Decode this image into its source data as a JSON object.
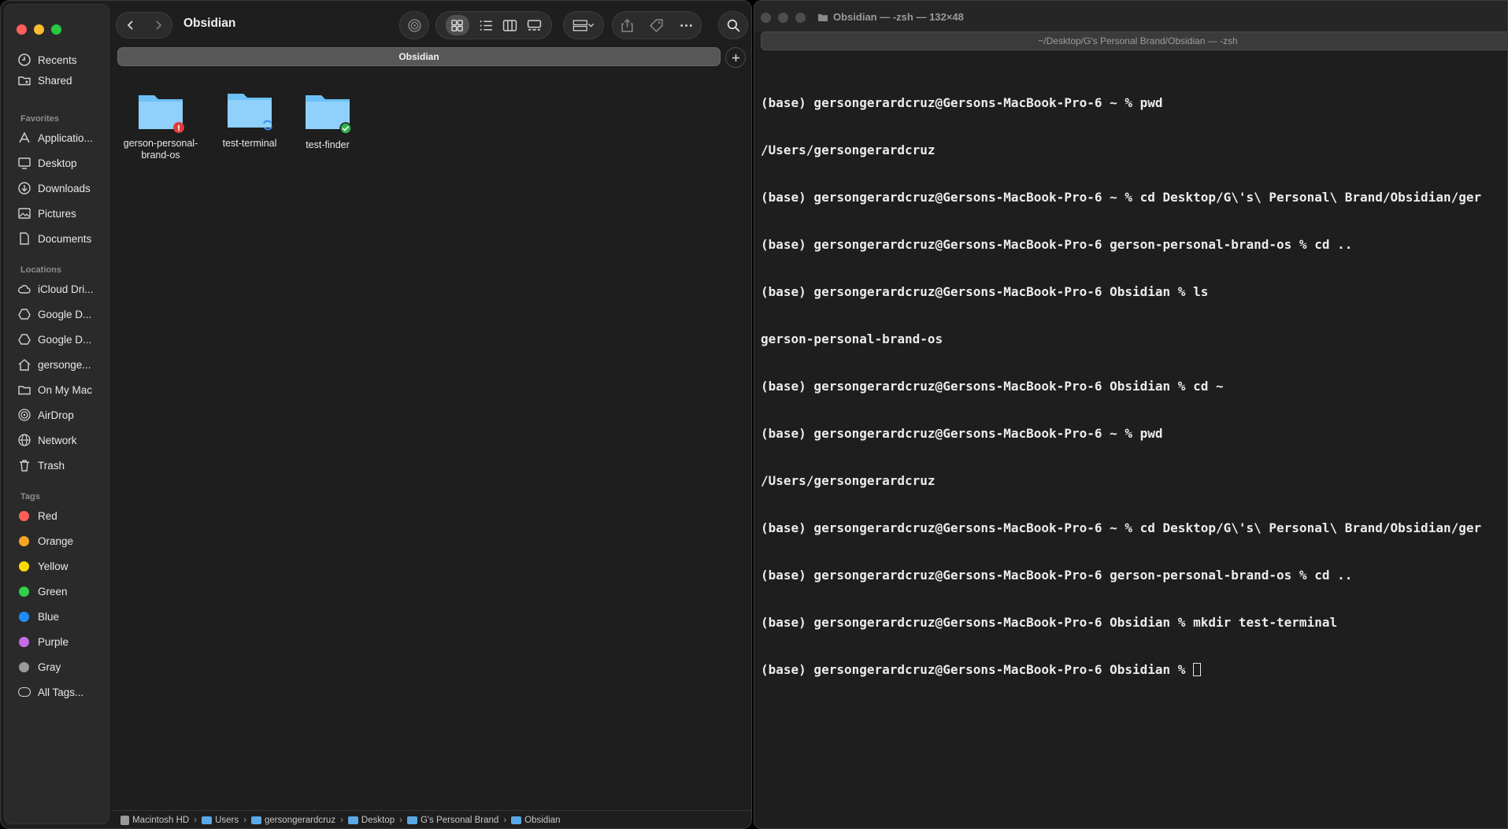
{
  "finder": {
    "title": "Obsidian",
    "path_tab": "Obsidian",
    "sidebar": {
      "top_items": [
        {
          "label": "Recents",
          "icon": "clock-icon"
        },
        {
          "label": "Shared",
          "icon": "shared-folder-icon"
        }
      ],
      "favorites_heading": "Favorites",
      "favorites": [
        {
          "label": "Applicatio...",
          "icon": "applications-icon"
        },
        {
          "label": "Desktop",
          "icon": "desktop-icon"
        },
        {
          "label": "Downloads",
          "icon": "download-icon"
        },
        {
          "label": "Pictures",
          "icon": "pictures-icon"
        },
        {
          "label": "Documents",
          "icon": "document-icon"
        }
      ],
      "locations_heading": "Locations",
      "locations": [
        {
          "label": "iCloud Dri...",
          "icon": "cloud-icon"
        },
        {
          "label": "Google D...",
          "icon": "google-drive-icon"
        },
        {
          "label": "Google D...",
          "icon": "google-drive-icon"
        },
        {
          "label": "gersonge...",
          "icon": "home-icon"
        },
        {
          "label": "On My Mac",
          "icon": "folder-icon"
        },
        {
          "label": "AirDrop",
          "icon": "airdrop-icon"
        },
        {
          "label": "Network",
          "icon": "globe-icon"
        },
        {
          "label": "Trash",
          "icon": "trash-icon"
        }
      ],
      "tags_heading": "Tags",
      "tags": [
        {
          "label": "Red",
          "color": "#fe5f57"
        },
        {
          "label": "Orange",
          "color": "#f6a623"
        },
        {
          "label": "Yellow",
          "color": "#fedb00"
        },
        {
          "label": "Green",
          "color": "#32d14a"
        },
        {
          "label": "Blue",
          "color": "#1d8cf8"
        },
        {
          "label": "Purple",
          "color": "#c76ce8"
        },
        {
          "label": "Gray",
          "color": "#9b9b9b"
        }
      ],
      "all_tags": "All Tags..."
    },
    "files": [
      {
        "name": "gerson-personal-brand-os",
        "badge": "error-badge-icon",
        "badge_color": "#e03c3c"
      },
      {
        "name": "test-terminal",
        "badge": "sync-badge-icon",
        "badge_color": "#3a8ef0"
      },
      {
        "name": "test-finder",
        "badge": "check-badge-icon",
        "badge_color": "#2fb14c"
      }
    ],
    "path_bar": [
      "Macintosh HD",
      "Users",
      "gersongerardcruz",
      "Desktop",
      "G's Personal Brand",
      "Obsidian"
    ]
  },
  "terminal": {
    "title": "Obsidian — -zsh — 132×48",
    "tab": "~/Desktop/G's Personal Brand/Obsidian — -zsh",
    "lines": [
      "(base) gersongerardcruz@Gersons-MacBook-Pro-6 ~ % pwd",
      "/Users/gersongerardcruz",
      "(base) gersongerardcruz@Gersons-MacBook-Pro-6 ~ % cd Desktop/G\\'s\\ Personal\\ Brand/Obsidian/ger",
      "(base) gersongerardcruz@Gersons-MacBook-Pro-6 gerson-personal-brand-os % cd ..",
      "(base) gersongerardcruz@Gersons-MacBook-Pro-6 Obsidian % ls",
      "gerson-personal-brand-os",
      "(base) gersongerardcruz@Gersons-MacBook-Pro-6 Obsidian % cd ~",
      "(base) gersongerardcruz@Gersons-MacBook-Pro-6 ~ % pwd",
      "/Users/gersongerardcruz",
      "(base) gersongerardcruz@Gersons-MacBook-Pro-6 ~ % cd Desktop/G\\'s\\ Personal\\ Brand/Obsidian/ger",
      "(base) gersongerardcruz@Gersons-MacBook-Pro-6 gerson-personal-brand-os % cd ..",
      "(base) gersongerardcruz@Gersons-MacBook-Pro-6 Obsidian % mkdir test-terminal"
    ],
    "prompt": "(base) gersongerardcruz@Gersons-MacBook-Pro-6 Obsidian % "
  }
}
